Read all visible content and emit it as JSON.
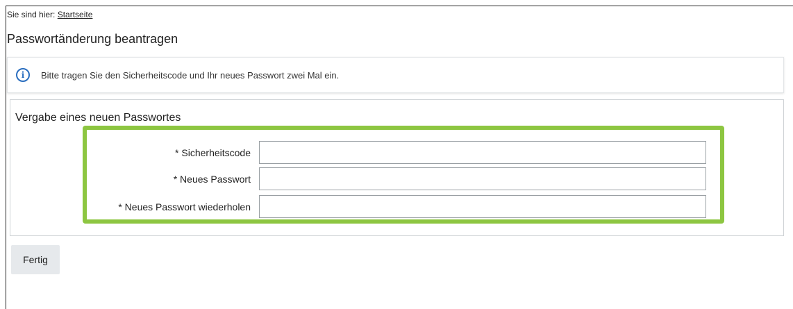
{
  "breadcrumb": {
    "prefix": "Sie sind hier:",
    "link": "Startseite"
  },
  "page": {
    "title": "Passwortänderung beantragen"
  },
  "info": {
    "icon": "info-icon",
    "text": "Bitte tragen Sie den Sicherheitscode und Ihr neues Passwort zwei Mal ein."
  },
  "form": {
    "section_title": "Vergabe eines neuen Passwortes",
    "highlight_color": "#8dc641",
    "fields": [
      {
        "label": "* Sicherheitscode",
        "value": ""
      },
      {
        "label": "* Neues Passwort",
        "value": ""
      },
      {
        "label": "* Neues Passwort wiederholen",
        "value": ""
      }
    ]
  },
  "actions": {
    "submit_label": "Fertig"
  }
}
